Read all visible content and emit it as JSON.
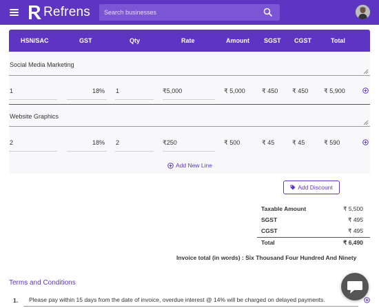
{
  "header": {
    "brand": "Refrens",
    "search_placeholder": "Search businesses",
    "brand_color": "#5d35c2"
  },
  "table": {
    "columns": [
      "HSN/SAC",
      "GST",
      "Qty",
      "Rate",
      "Amount",
      "SGST",
      "CGST",
      "Total"
    ],
    "items": [
      {
        "description": "Social Media Marketing",
        "hsn": "1",
        "gst": "18%",
        "qty": "1",
        "rate": "₹5,000",
        "amount": "₹ 5,000",
        "sgst": "₹ 450",
        "cgst": "₹ 450",
        "total": "₹ 5,900"
      },
      {
        "description": "Website Graphics",
        "hsn": "2",
        "gst": "18%",
        "qty": "2",
        "rate": "₹250",
        "amount": "₹ 500",
        "sgst": "₹ 45",
        "cgst": "₹ 45",
        "total": "₹ 590"
      }
    ],
    "add_line_label": "Add New Line"
  },
  "discount_button": "Add Discount",
  "totals": {
    "taxable_label": "Taxable Amount",
    "taxable_value": "₹ 5,500",
    "sgst_label": "SGST",
    "sgst_value": "₹ 495",
    "cgst_label": "CGST",
    "cgst_value": "₹ 495",
    "total_label": "Total",
    "total_value": "₹ 6,490"
  },
  "words": "Invoice total (in words) : Six Thousand Four Hundred And Ninety",
  "terms": {
    "title": "Terms and Conditions",
    "items": [
      {
        "number": "1.",
        "text": "Please pay within 15 days from the date of invoice, overdue interest @ 14% will be charged on delayed payments."
      }
    ]
  }
}
